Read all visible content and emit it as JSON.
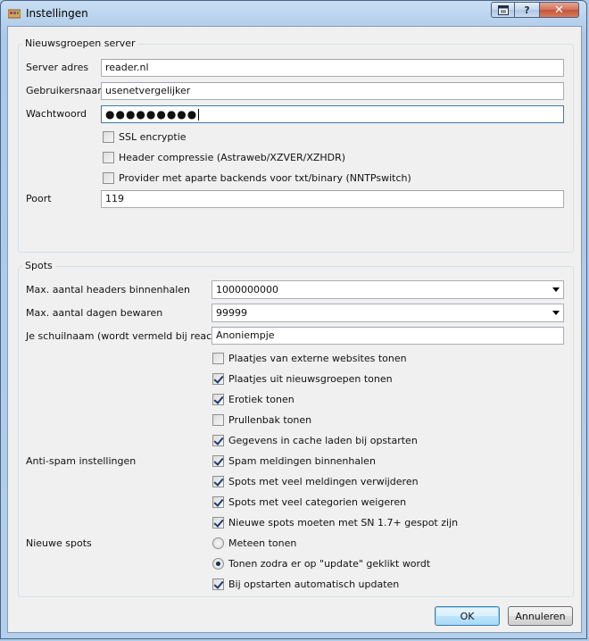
{
  "window": {
    "title": "Instellingen",
    "close_glyph": "✕",
    "help_glyph": "?"
  },
  "server": {
    "group_title": "Nieuwsgroepen server",
    "address_label": "Server adres",
    "address_value": "reader.nl",
    "username_label": "Gebruikersnaam",
    "username_value": "usenetvergelijker",
    "password_label": "Wachtwoord",
    "password_mask": "●●●●●●●●●",
    "options": [
      {
        "label": "SSL encryptie",
        "checked": false
      },
      {
        "label": "Header compressie (Astraweb/XZVER/XZHDR)",
        "checked": false
      },
      {
        "label": "Provider met  aparte backends voor txt/binary (NNTPswitch)",
        "checked": false
      }
    ],
    "port_label": "Poort",
    "port_value": "119"
  },
  "spots": {
    "group_title": "Spots",
    "max_headers_label": "Max. aantal headers binnenhalen",
    "max_headers_value": "1000000000",
    "max_days_label": "Max. aantal dagen bewaren",
    "max_days_value": "99999",
    "nickname_label": "Je schuilnaam (wordt vermeld bij reacties)",
    "nickname_value": "Anoniempje",
    "display_options": [
      {
        "label": "Plaatjes van externe websites tonen",
        "checked": false
      },
      {
        "label": "Plaatjes uit nieuwsgroepen tonen",
        "checked": true
      },
      {
        "label": "Erotiek tonen",
        "checked": true
      },
      {
        "label": "Prullenbak tonen",
        "checked": false
      },
      {
        "label": "Gegevens in cache laden bij opstarten",
        "checked": true
      }
    ],
    "antispam_label": "Anti-spam instellingen",
    "antispam_options": [
      {
        "label": "Spam meldingen binnenhalen",
        "checked": true
      },
      {
        "label": "Spots met veel meldingen verwijderen",
        "checked": true
      },
      {
        "label": "Spots met veel categorien weigeren",
        "checked": true
      },
      {
        "label": "Nieuwe spots moeten met SN 1.7+ gespot zijn",
        "checked": true
      }
    ],
    "new_spots_label": "Nieuwe spots",
    "new_spots_radios": [
      {
        "label": "Meteen tonen",
        "checked": false
      },
      {
        "label": "Tonen zodra er op \"update\" geklikt wordt",
        "checked": true
      }
    ],
    "auto_update": {
      "label": "Bij opstarten automatisch updaten",
      "checked": true
    }
  },
  "buttons": {
    "ok": "OK",
    "cancel": "Annuleren"
  }
}
